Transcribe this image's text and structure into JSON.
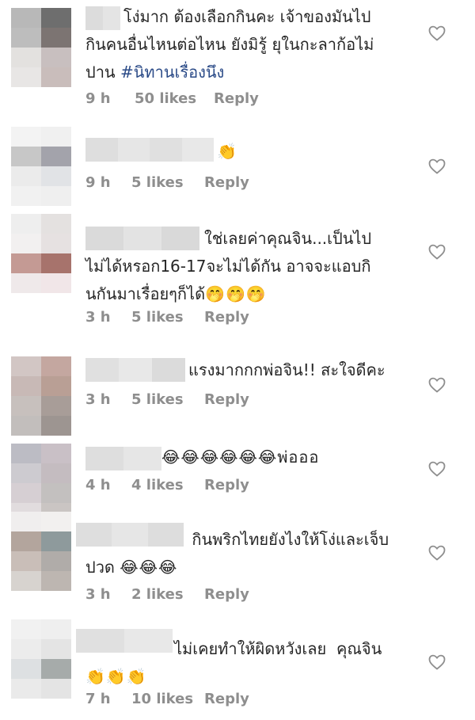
{
  "comments": [
    {
      "text": "โง่มาก ต้องเลือกกินคะ เจ้าของมันไป\nกินคนอื่นไหนต่อไหน ยังมิรู้ ยุในกะลาก้อไม่\nปาน ",
      "hashtag": "#นิทานเรื่องนึง",
      "emojis": "",
      "time": "9 h",
      "likes": "50 likes",
      "reply": "Reply"
    },
    {
      "text": "",
      "hashtag": "",
      "emojis": "👏",
      "time": "9 h",
      "likes": "5 likes",
      "reply": "Reply"
    },
    {
      "text": "ใช่เลยค่าคุณจิน...เป็นไป\nไม่ได้หรอก16-17จะไม่ได้กัน อาจจะแอบกิ\nนกันมาเรื่อยๆก็ได้",
      "hashtag": "",
      "emojis": "🤭🤭🤭",
      "time": "3 h",
      "likes": "5 likes",
      "reply": "Reply"
    },
    {
      "text": "แรงมากกกพ่อจิน!! สะใจดีคะ",
      "hashtag": "",
      "emojis": "",
      "time": "3 h",
      "likes": "5 likes",
      "reply": "Reply"
    },
    {
      "text": "",
      "hashtag": "",
      "emojis": "😂😂😂😂😂😂พ่อออ",
      "time": "4 h",
      "likes": "4 likes",
      "reply": "Reply"
    },
    {
      "text": " กินพริกไทยยังไงให้โง่และเจ็บ\nปวด ",
      "hashtag": "",
      "emojis": "😂😂😂",
      "time": "3 h",
      "likes": "2 likes",
      "reply": "Reply"
    },
    {
      "text": "ไม่เคยทำให้ผิดหวังเลย  คุณจิน\n",
      "hashtag": "",
      "emojis": "👏👏👏",
      "time": "7 h",
      "likes": "10 likes",
      "reply": "Reply"
    }
  ],
  "colors": {
    "meta_gray": "#8e8e8e",
    "hashtag_blue": "#2a4a87",
    "text": "#262626"
  },
  "icons": {
    "like": "heart-outline-icon"
  }
}
